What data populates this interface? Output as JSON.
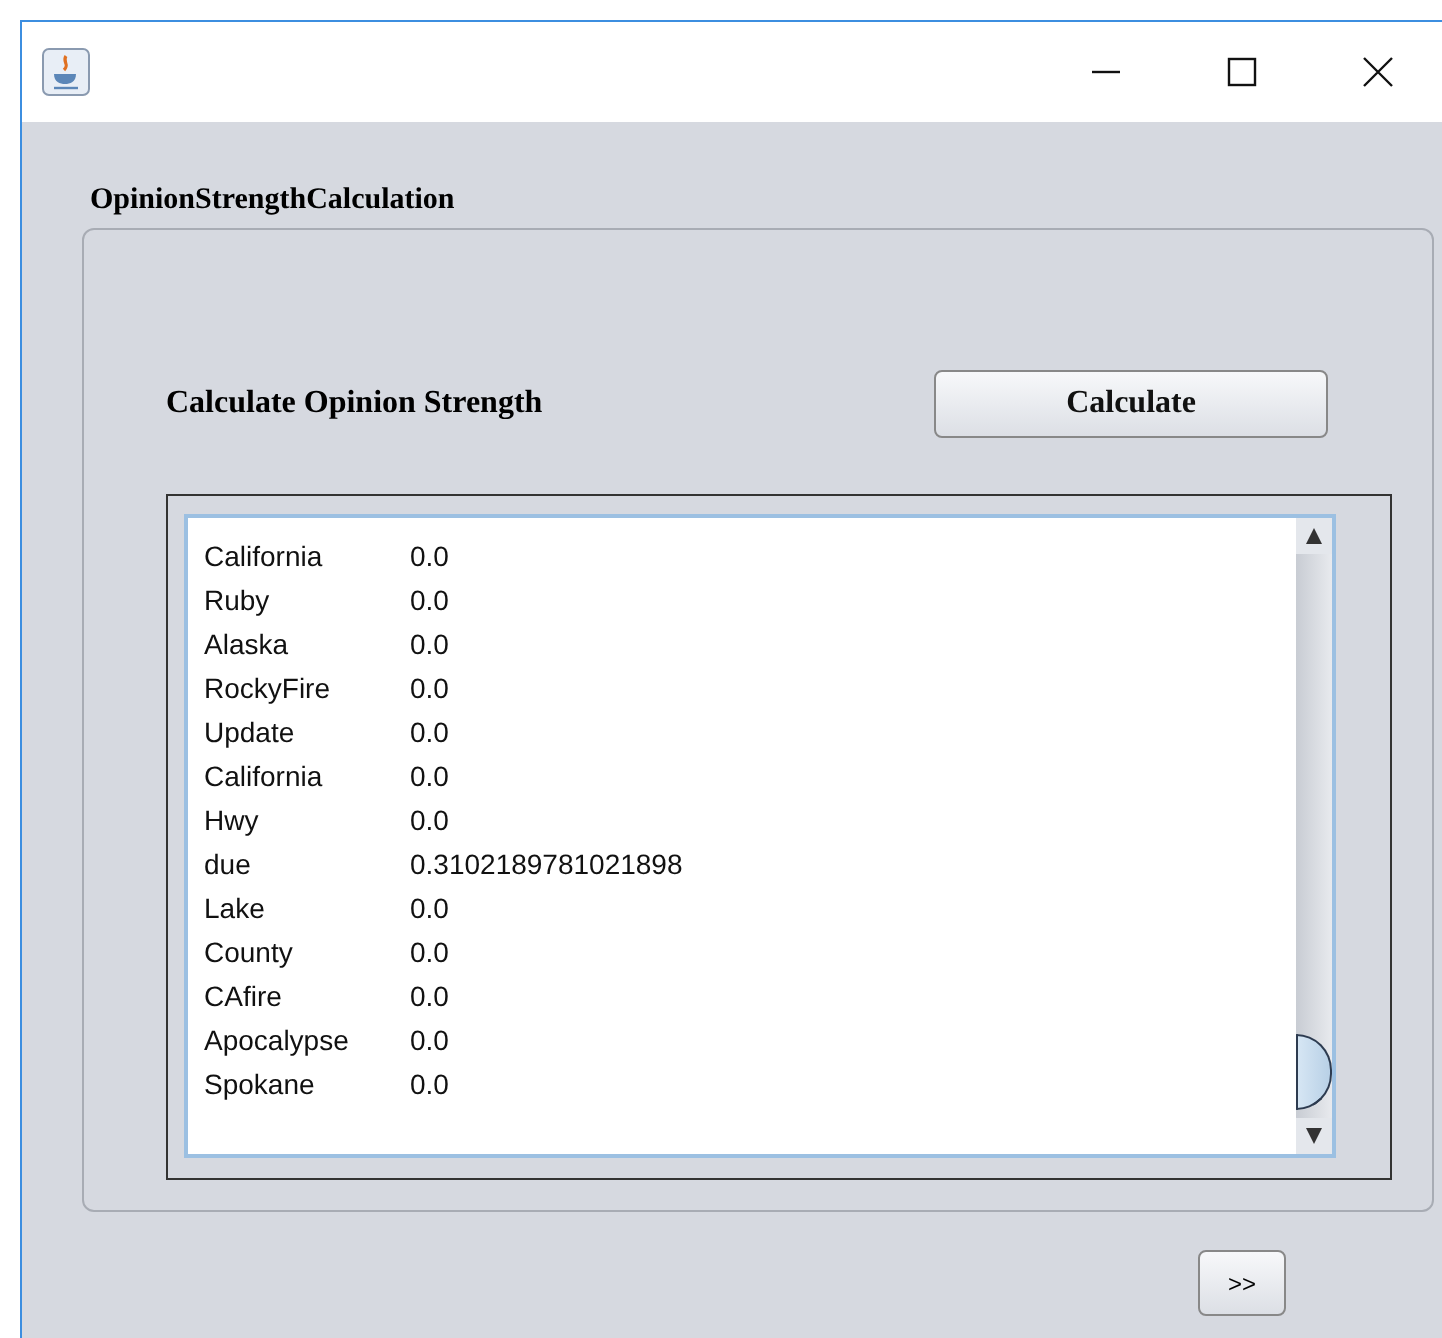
{
  "group": {
    "title": "OpinionStrengthCalculation"
  },
  "prompt": "Calculate Opinion Strength",
  "calculate_button": "Calculate",
  "results": [
    {
      "term": "California",
      "score": "0.0"
    },
    {
      "term": "Ruby",
      "score": "0.0"
    },
    {
      "term": "Alaska",
      "score": "0.0"
    },
    {
      "term": "RockyFire",
      "score": "0.0"
    },
    {
      "term": "Update",
      "score": "0.0"
    },
    {
      "term": "California",
      "score": "0.0"
    },
    {
      "term": "Hwy",
      "score": "0.0"
    },
    {
      "term": "due",
      "score": "0.3102189781021898"
    },
    {
      "term": "Lake",
      "score": "0.0"
    },
    {
      "term": "County",
      "score": "0.0"
    },
    {
      "term": "CAfire",
      "score": "0.0"
    },
    {
      "term": "Apocalypse",
      "score": "0.0"
    },
    {
      "term": "Spokane",
      "score": "0.0"
    }
  ],
  "next_button": ">>"
}
